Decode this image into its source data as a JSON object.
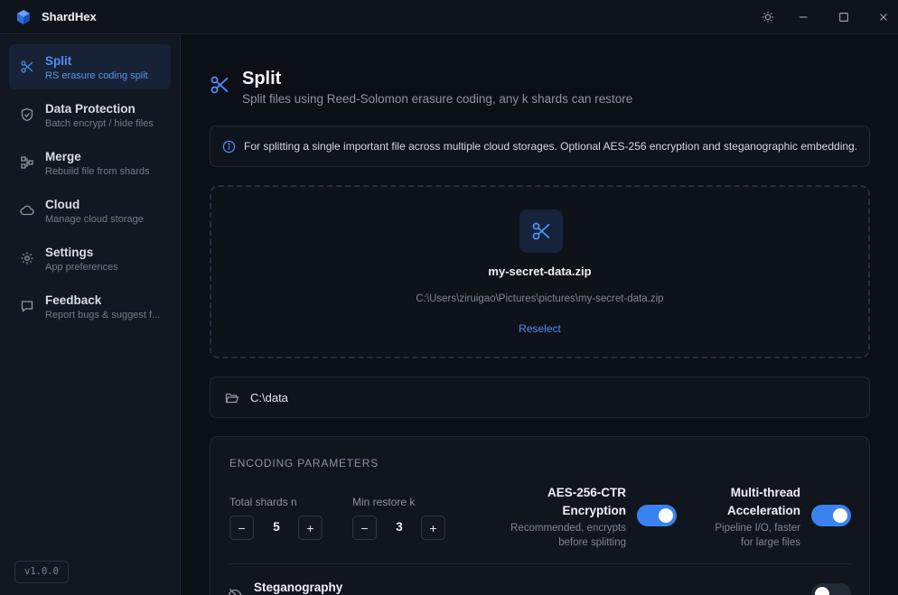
{
  "app": {
    "title": "ShardHex"
  },
  "sidebar": {
    "items": [
      {
        "title": "Split",
        "subtitle": "RS erasure coding split",
        "icon": "scissors-icon",
        "active": true
      },
      {
        "title": "Data Protection",
        "subtitle": "Batch encrypt / hide files",
        "icon": "shield-icon"
      },
      {
        "title": "Merge",
        "subtitle": "Rebuild file from shards",
        "icon": "merge-icon"
      },
      {
        "title": "Cloud",
        "subtitle": "Manage cloud storage",
        "icon": "cloud-icon"
      },
      {
        "title": "Settings",
        "subtitle": "App preferences",
        "icon": "gear-icon"
      },
      {
        "title": "Feedback",
        "subtitle": "Report bugs & suggest f...",
        "icon": "message-icon"
      }
    ],
    "version": "v1.0.0"
  },
  "page": {
    "title": "Split",
    "subtitle": "Split files using Reed-Solomon erasure coding, any k shards can restore"
  },
  "info": {
    "text": "For splitting a single important file across multiple cloud storages. Optional AES-256 encryption and steganographic embedding."
  },
  "file": {
    "name": "my-secret-data.zip",
    "path": "C:\\Users\\ziruigao\\Pictures\\pictures\\my-secret-data.zip",
    "reselect_label": "Reselect"
  },
  "output": {
    "dir": "C:\\data"
  },
  "params": {
    "title": "ENCODING PARAMETERS",
    "total_shards": {
      "label": "Total shards n",
      "value": "5",
      "dec": "−",
      "inc": "+"
    },
    "min_restore": {
      "label": "Min restore k",
      "value": "3",
      "dec": "−",
      "inc": "+"
    },
    "aes": {
      "title_1": "AES-256-CTR",
      "title_2": "Encryption",
      "desc_1": "Recommended, encrypts",
      "desc_2": "before splitting",
      "enabled": true
    },
    "multithread": {
      "title_1": "Multi-thread",
      "title_2": "Acceleration",
      "desc_1": "Pipeline I/O, faster",
      "desc_2": "for large files",
      "enabled": true
    },
    "steganography": {
      "title": "Steganography",
      "enabled": false
    }
  },
  "colors": {
    "accent": "#4f8ff7",
    "toggle_on": "#3a82f0",
    "background": "#0b0f16",
    "sidebar": "#121821"
  }
}
